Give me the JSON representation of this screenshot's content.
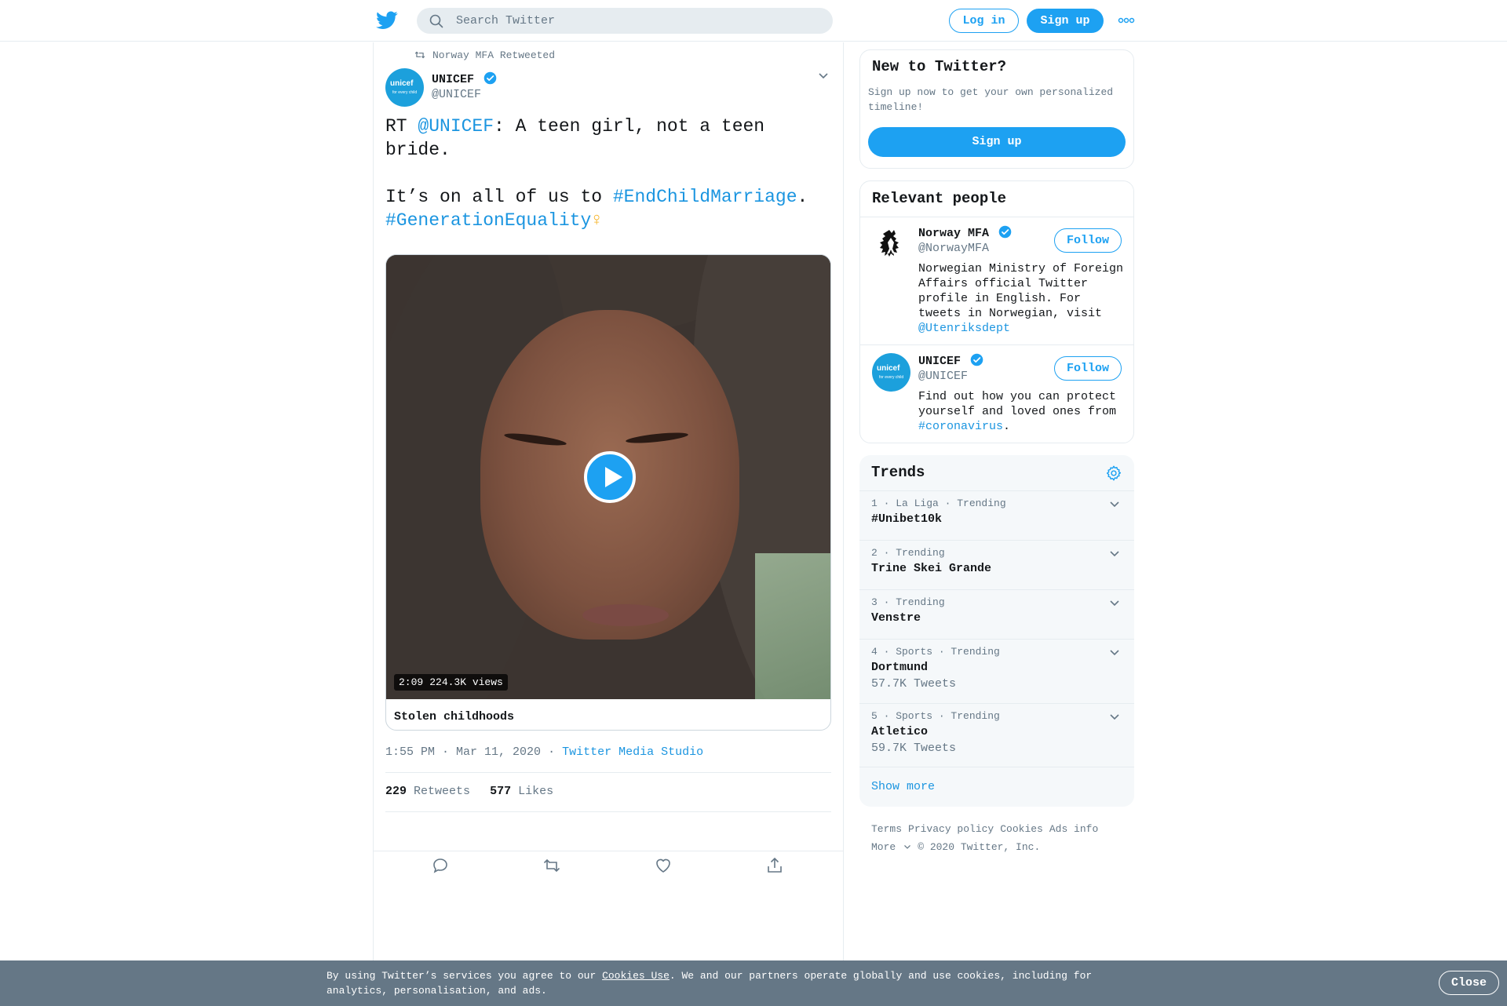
{
  "header": {
    "search_placeholder": "Search Twitter",
    "login_label": "Log in",
    "signup_label": "Sign up"
  },
  "tweet": {
    "retweeted_by": "Norway MFA Retweeted",
    "author_name": "UNICEF",
    "author_handle": "@UNICEF",
    "text_rt": "RT ",
    "text_mention": "@UNICEF",
    "text_line1_rest": ": A teen girl, not a teen bride.",
    "text_line2_start": "It’s on all of us to ",
    "text_hashtag1": "#EndChildMarriage",
    "text_period": ".",
    "text_hashtag2": "#GenerationEquality",
    "text_emoji": "♀",
    "video_duration": "2:09",
    "video_views": "224.3K views",
    "media_caption": "Stolen childhoods",
    "timestamp": "1:55 PM · Mar 11, 2020",
    "separator": "·",
    "source": "Twitter Media Studio",
    "retweets_count": "229",
    "retweets_label": "Retweets",
    "likes_count": "577",
    "likes_label": "Likes"
  },
  "sidebar": {
    "new_to_twitter": {
      "title": "New to Twitter?",
      "description": "Sign up now to get your own personalized timeline!",
      "signup_label": "Sign up"
    },
    "relevant_people": {
      "title": "Relevant people",
      "people": [
        {
          "name": "Norway MFA",
          "handle": "@NorwayMFA",
          "bio": "Norwegian Ministry of Foreign Affairs official Twitter profile in English. For tweets in Norwegian, visit ",
          "bio_link": "@Utenriksdept",
          "bio_end": "",
          "follow_label": "Follow"
        },
        {
          "name": "UNICEF",
          "handle": "@UNICEF",
          "bio": "Find out how you can protect yourself and loved ones from ",
          "bio_link": "#coronavirus",
          "bio_end": ".",
          "follow_label": "Follow"
        }
      ]
    },
    "trends": {
      "title": "Trends",
      "items": [
        {
          "meta": "1 · La Liga · Trending",
          "name": "#Unibet10k",
          "count": ""
        },
        {
          "meta": "2 · Trending",
          "name": "Trine Skei Grande",
          "count": ""
        },
        {
          "meta": "3 · Trending",
          "name": "Venstre",
          "count": ""
        },
        {
          "meta": "4 · Sports · Trending",
          "name": "Dortmund",
          "count": "57.7K Tweets"
        },
        {
          "meta": "5 · Sports · Trending",
          "name": "Atletico",
          "count": "59.7K Tweets"
        }
      ],
      "show_more": "Show more"
    },
    "footer": {
      "terms": "Terms",
      "privacy": "Privacy policy",
      "cookies": "Cookies",
      "ads": "Ads info",
      "more": "More",
      "copyright": "© 2020 Twitter, Inc."
    }
  },
  "cookie_banner": {
    "text_before": "By using Twitter’s services you agree to our ",
    "link": "Cookies Use",
    "text_after": ". We and our partners operate globally and use cookies, including for analytics, personalisation, and ads.",
    "close_label": "Close"
  },
  "colors": {
    "brand": "#1da1f2",
    "link": "#1b95e0",
    "muted": "#657786"
  }
}
